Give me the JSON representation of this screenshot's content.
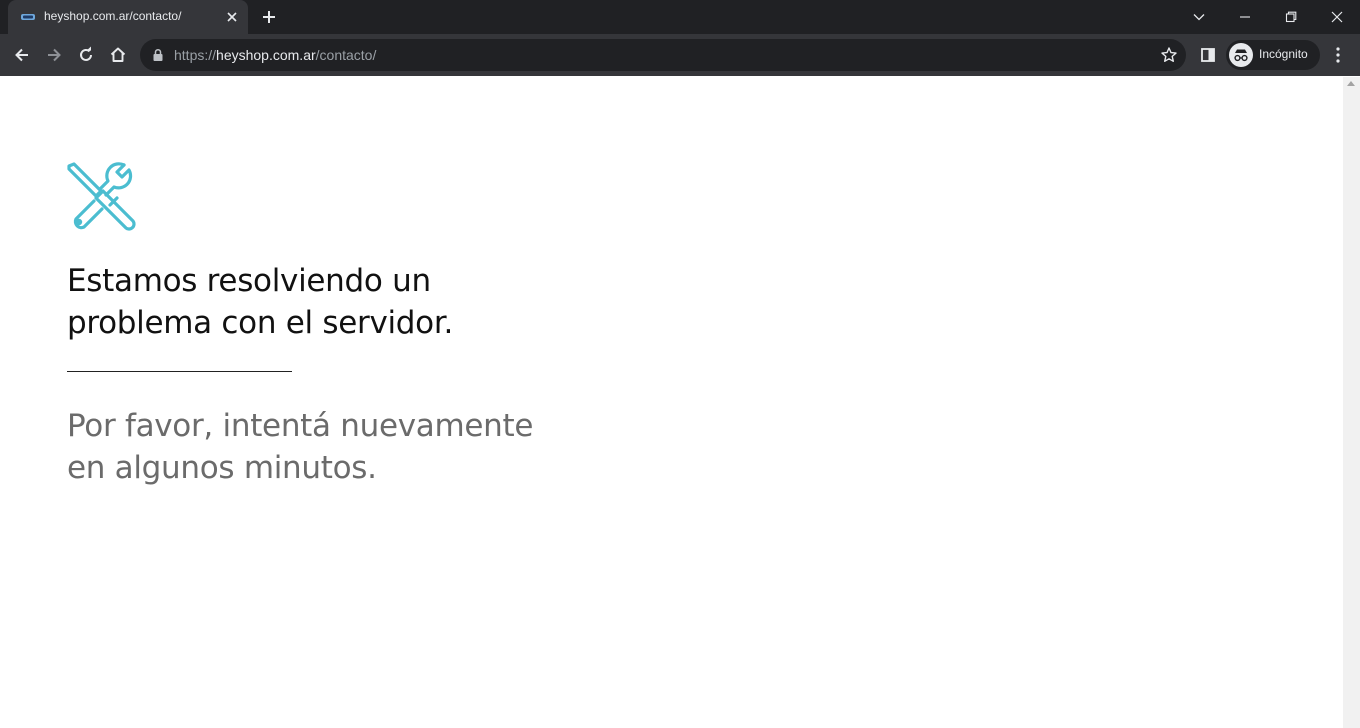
{
  "browser": {
    "tab": {
      "title": "heyshop.com.ar/contacto/",
      "favicon": "heyshop-logo-icon"
    },
    "address_bar": {
      "scheme": "https://",
      "host": "heyshop.com.ar",
      "path": "/contacto/"
    },
    "profile_label": "Incógnito",
    "icons": [
      "back-icon",
      "forward-icon",
      "reload-icon",
      "home-icon",
      "lock-icon",
      "star-icon",
      "side-panel-icon",
      "incognito-icon",
      "menu-icon",
      "tab-search-icon",
      "minimize-icon",
      "restore-icon",
      "close-icon",
      "new-tab-icon"
    ]
  },
  "page": {
    "icon": "tools-icon",
    "headline": "Estamos resolviendo un problema con el servidor.",
    "message": "Por favor, intentá nuevamente en algunos minutos."
  },
  "colors": {
    "accent": "#4bbdd0",
    "headline": "#111111",
    "message": "#6b6b6b",
    "chrome_dark": "#202124",
    "chrome_toolbar": "#35363a"
  }
}
